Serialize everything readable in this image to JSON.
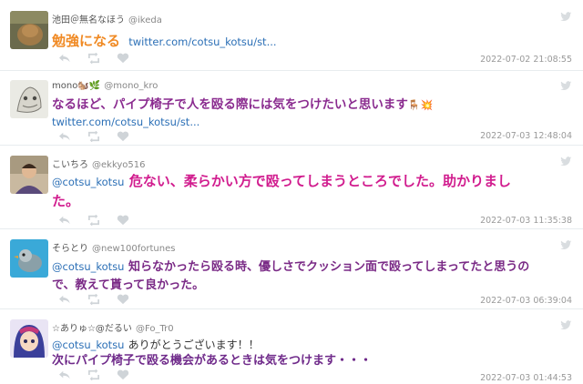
{
  "tweets": [
    {
      "name": "池田＠無名なほう",
      "handle": "@ikeda",
      "text": "勉強になる",
      "link": "twitter.com/cotsu_kotsu/st...",
      "timestamp": "2022-07-02 21:08:55",
      "text_color": "#f08a24"
    },
    {
      "name": "mono🐿️🌿",
      "handle": "@mono_kro",
      "text": "なるほど、パイプ椅子で人を殴る際には気をつけたいと思います",
      "emoji": "🪑💥",
      "link": "twitter.com/cotsu_kotsu/st...",
      "timestamp": "2022-07-03 12:48:04",
      "text_color": "#8a2b8f"
    },
    {
      "name": "こいちろ",
      "handle": "@ekkyo516",
      "mention": "@cotsu_kotsu",
      "text_line1": "危ない、柔らかい方で殴ってしまうところでした。助かりまし",
      "text_line2": "た。",
      "timestamp": "2022-07-03 11:35:38",
      "text_color": "#d11c8e"
    },
    {
      "name": "そらとり",
      "handle": "@new100fortunes",
      "mention": "@cotsu_kotsu",
      "text_line1": "知らなかったら殴る時、優しさでクッション面で殴ってしまってたと思うの",
      "text_line2": "で、教えて貰って良かった。",
      "timestamp": "2022-07-03 06:39:04",
      "text_color": "#7a2a86"
    },
    {
      "name": "☆ありゅ☆@だるい",
      "handle": "@Fo_Tr0",
      "mention": "@cotsu_kotsu",
      "text_line1": "ありがとうございます！！",
      "text_line2": "次にパイプ椅子で殴る機会があるときは気をつけます・・・",
      "timestamp": "2022-07-03 01:44:53",
      "text_color": "#6f2a8a"
    }
  ],
  "icons": {
    "reply": "reply-icon",
    "retweet": "retweet-icon",
    "like": "heart-icon",
    "bird": "twitter-bird-icon"
  }
}
